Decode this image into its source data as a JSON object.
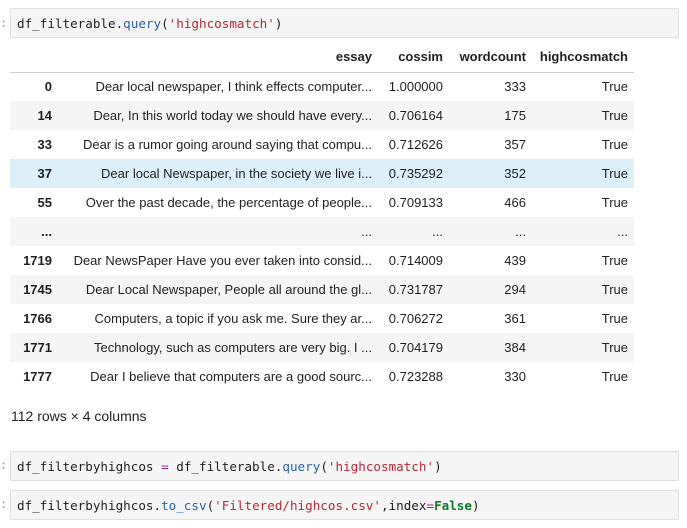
{
  "cells": [
    {
      "code_tokens": [
        {
          "text": "df_filterable.",
          "cls": ""
        },
        {
          "text": "query",
          "cls": "tok-fn"
        },
        {
          "text": "(",
          "cls": ""
        },
        {
          "text": "'highcosmatch'",
          "cls": "tok-str"
        },
        {
          "text": ")",
          "cls": ""
        }
      ]
    },
    {
      "code_tokens": [
        {
          "text": "df_filterbyhighcos ",
          "cls": ""
        },
        {
          "text": "=",
          "cls": "tok-op"
        },
        {
          "text": " df_filterable.",
          "cls": ""
        },
        {
          "text": "query",
          "cls": "tok-fn"
        },
        {
          "text": "(",
          "cls": ""
        },
        {
          "text": "'highcosmatch'",
          "cls": "tok-str"
        },
        {
          "text": ")",
          "cls": ""
        }
      ]
    },
    {
      "code_tokens": [
        {
          "text": "df_filterbyhighcos.",
          "cls": ""
        },
        {
          "text": "to_csv",
          "cls": "tok-fn"
        },
        {
          "text": "(",
          "cls": ""
        },
        {
          "text": "'Filtered/highcos.csv'",
          "cls": "tok-str"
        },
        {
          "text": ",index",
          "cls": ""
        },
        {
          "text": "=",
          "cls": "tok-op"
        },
        {
          "text": "False",
          "cls": "tok-kw"
        },
        {
          "text": ")",
          "cls": ""
        }
      ]
    }
  ],
  "dataframe": {
    "columns": [
      "essay",
      "cossim",
      "wordcount",
      "highcosmatch"
    ],
    "rows": [
      {
        "index": "0",
        "essay": "Dear local newspaper, I think effects computer...",
        "cossim": "1.000000",
        "wordcount": "333",
        "highcosmatch": "True"
      },
      {
        "index": "14",
        "essay": "Dear, In this world today we should have every...",
        "cossim": "0.706164",
        "wordcount": "175",
        "highcosmatch": "True"
      },
      {
        "index": "33",
        "essay": "Dear is a rumor going around saying that compu...",
        "cossim": "0.712626",
        "wordcount": "357",
        "highcosmatch": "True"
      },
      {
        "index": "37",
        "essay": "Dear local Newspaper, in the society we live i...",
        "cossim": "0.735292",
        "wordcount": "352",
        "highcosmatch": "True",
        "hovered": true
      },
      {
        "index": "55",
        "essay": "Over the past decade, the percentage of people...",
        "cossim": "0.709133",
        "wordcount": "466",
        "highcosmatch": "True"
      },
      {
        "index": "...",
        "essay": "...",
        "cossim": "...",
        "wordcount": "...",
        "highcosmatch": "..."
      },
      {
        "index": "1719",
        "essay": "Dear NewsPaper Have you ever taken into consid...",
        "cossim": "0.714009",
        "wordcount": "439",
        "highcosmatch": "True"
      },
      {
        "index": "1745",
        "essay": "Dear Local Newspaper, People all around the gl...",
        "cossim": "0.731787",
        "wordcount": "294",
        "highcosmatch": "True"
      },
      {
        "index": "1766",
        "essay": "Computers, a topic if you ask me. Sure they ar...",
        "cossim": "0.706272",
        "wordcount": "361",
        "highcosmatch": "True"
      },
      {
        "index": "1771",
        "essay": "Technology, such as computers are very big. I ...",
        "cossim": "0.704179",
        "wordcount": "384",
        "highcosmatch": "True"
      },
      {
        "index": "1777",
        "essay": "Dear I believe that computers are a good sourc...",
        "cossim": "0.723288",
        "wordcount": "330",
        "highcosmatch": "True"
      }
    ],
    "shape_text": "112 rows × 4 columns"
  },
  "colors": {
    "string": "#b22a3a",
    "function": "#2a62a8",
    "operator": "#9b2393",
    "keyword": "#0c7a2a",
    "hover_row": "#dcf0fa"
  }
}
